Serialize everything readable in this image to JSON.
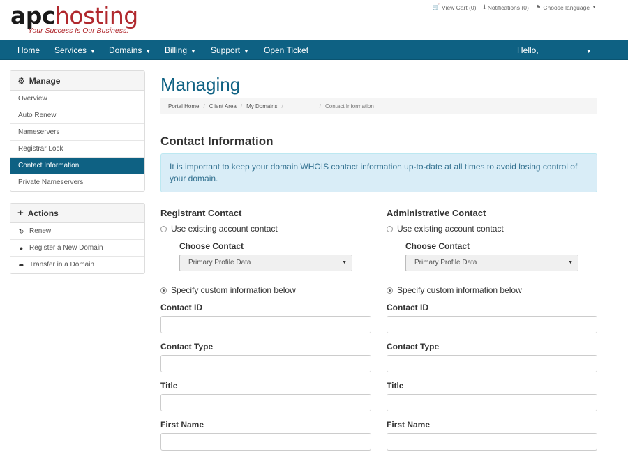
{
  "brand": {
    "logo_apc": "apc",
    "logo_hosting": "hosting",
    "tagline": "Your Success Is Our Business."
  },
  "top_links": {
    "cart": "View Cart (0)",
    "notifications": "Notifications (0)",
    "language": "Choose language"
  },
  "nav": {
    "home": "Home",
    "services": "Services",
    "domains": "Domains",
    "billing": "Billing",
    "support": "Support",
    "open_ticket": "Open Ticket",
    "hello": "Hello,"
  },
  "sidebar": {
    "manage": {
      "title": "Manage",
      "items": [
        "Overview",
        "Auto Renew",
        "Nameservers",
        "Registrar Lock",
        "Contact Information",
        "Private Nameservers"
      ],
      "active": "Contact Information"
    },
    "actions": {
      "title": "Actions",
      "items": [
        "Renew",
        "Register a New Domain",
        "Transfer in a Domain"
      ]
    }
  },
  "page": {
    "title": "Managing",
    "breadcrumb": [
      "Portal Home",
      "Client Area",
      "My Domains",
      "Contact Information"
    ],
    "section_title": "Contact Information",
    "alert": "It is important to keep your domain WHOIS contact information up-to-date at all times to avoid losing control of your domain."
  },
  "registrant": {
    "title": "Registrant Contact",
    "use_existing": "Use existing account contact",
    "choose_contact": "Choose Contact",
    "select_value": "Primary Profile Data",
    "custom": "Specify custom information below",
    "fields": [
      "Contact ID",
      "Contact Type",
      "Title",
      "First Name"
    ],
    "values": [
      "",
      "",
      "",
      ""
    ]
  },
  "administrative": {
    "title": "Administrative Contact",
    "use_existing": "Use existing account contact",
    "choose_contact": "Choose Contact",
    "select_value": "Primary Profile Data",
    "custom": "Specify custom information below",
    "fields": [
      "Contact ID",
      "Contact Type",
      "Title",
      "First Name"
    ],
    "values": [
      "",
      "",
      "",
      ""
    ]
  },
  "colors": {
    "primary": "#0e6183",
    "alert_bg": "#d9edf7",
    "alert_text": "#31708f",
    "logo_red": "#b0282d",
    "logo_blue": "#27a9d6"
  }
}
